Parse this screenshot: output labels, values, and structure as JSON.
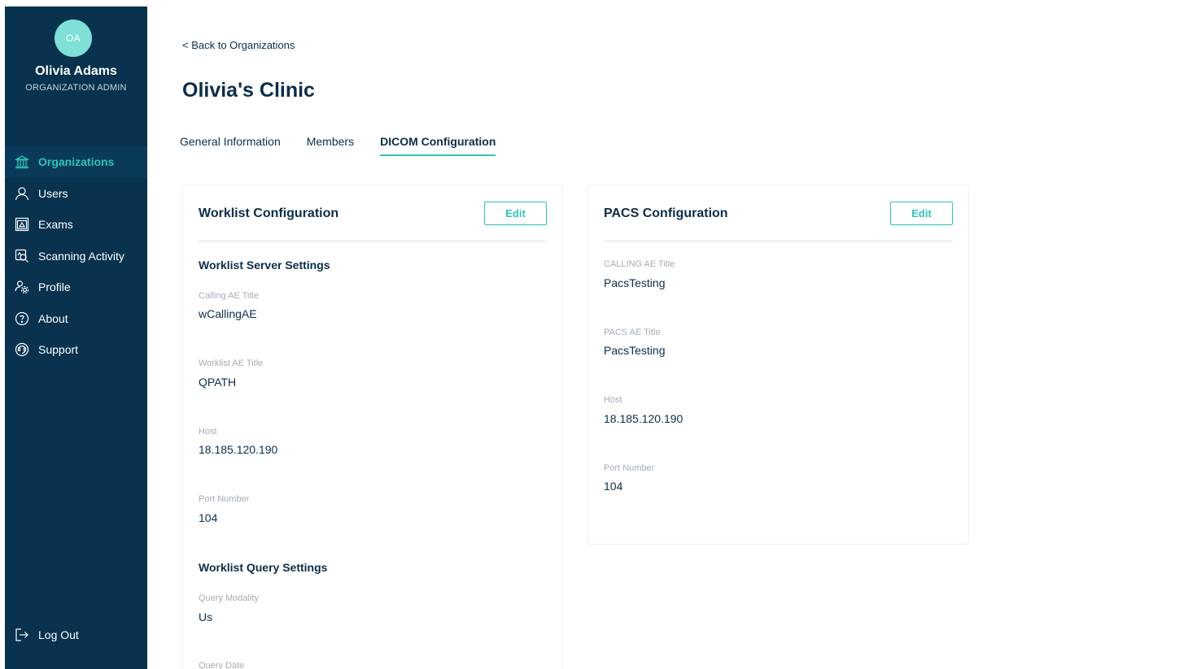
{
  "user": {
    "initials": "OA",
    "name": "Olivia Adams",
    "role": "ORGANIZATION ADMIN"
  },
  "sidebar": {
    "items": [
      {
        "label": "Organizations",
        "icon": "building-icon",
        "active": true
      },
      {
        "label": "Users",
        "icon": "user-icon",
        "active": false
      },
      {
        "label": "Exams",
        "icon": "exams-icon",
        "active": false
      },
      {
        "label": "Scanning Activity",
        "icon": "scanning-activity-icon",
        "active": false
      },
      {
        "label": "Profile",
        "icon": "profile-settings-icon",
        "active": false
      },
      {
        "label": "About",
        "icon": "help-circle-icon",
        "active": false
      },
      {
        "label": "Support",
        "icon": "support-icon",
        "active": false
      }
    ],
    "logout_label": "Log Out",
    "logout_icon": "logout-icon"
  },
  "header": {
    "back_link": "< Back to Organizations",
    "title": "Olivia's Clinic"
  },
  "tabs": [
    {
      "label": "General Information",
      "active": false
    },
    {
      "label": "Members",
      "active": false
    },
    {
      "label": "DICOM Configuration",
      "active": true
    }
  ],
  "worklist": {
    "title": "Worklist Configuration",
    "edit_label": "Edit",
    "server_section": "Worklist Server Settings",
    "calling_ae_label": "Calling AE Title",
    "calling_ae_value": "wCallingAE",
    "worklist_ae_label": "Worklist AE Title",
    "worklist_ae_value": "QPATH",
    "host_label": "Host",
    "host_value": "18.185.120.190",
    "port_label": "Port Number",
    "port_value": "104",
    "query_section": "Worklist Query Settings",
    "query_modality_label": "Query Modality",
    "query_modality_value": "Us",
    "query_date_label": "Query Date"
  },
  "pacs": {
    "title": "PACS Configuration",
    "edit_label": "Edit",
    "calling_ae_label": "CALLING AE Title",
    "calling_ae_value": "PacsTesting",
    "pacs_ae_label": "PACS AE Title",
    "pacs_ae_value": "PacsTesting",
    "host_label": "Host",
    "host_value": "18.185.120.190",
    "port_label": "Port Number",
    "port_value": "104"
  },
  "colors": {
    "sidebar_bg": "#08324e",
    "accent": "#2ec4b6",
    "avatar_bg": "#7fe0d8",
    "text_primary": "#0b2e4a",
    "label_gray": "#a3adb6"
  }
}
